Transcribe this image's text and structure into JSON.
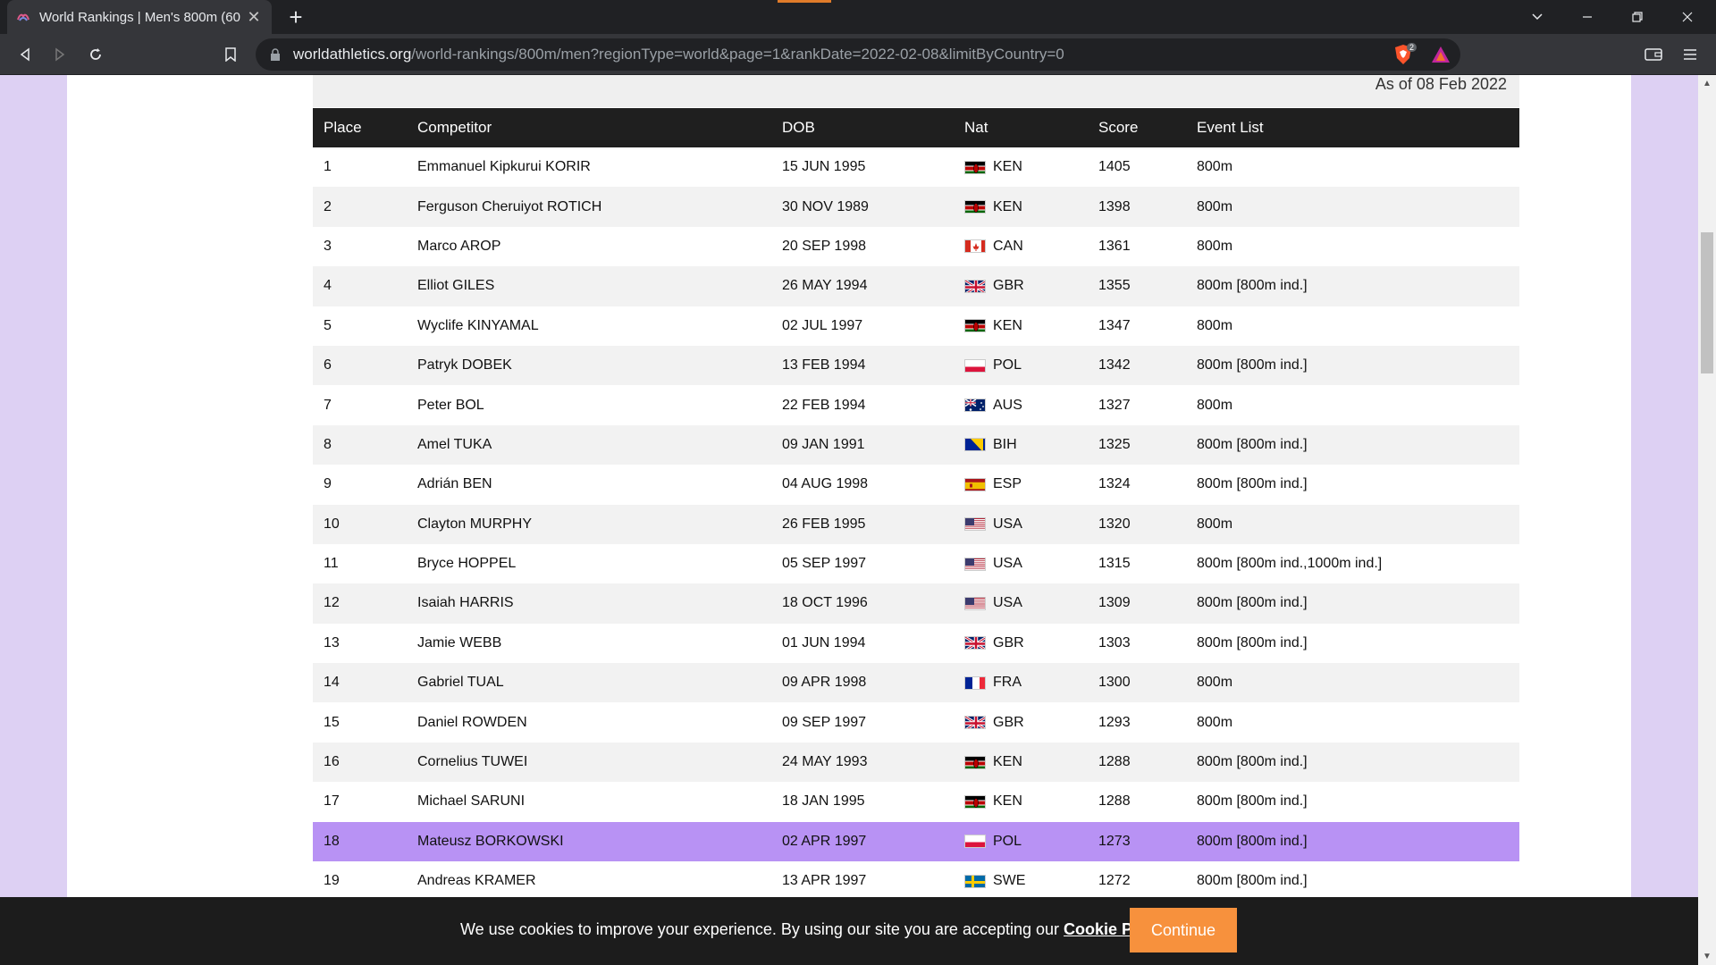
{
  "browser": {
    "tab_title": "World Rankings | Men's 800m (60",
    "tab_close": "✕",
    "new_tab": "+",
    "url_domain": "worldathletics.org",
    "url_path": "/world-rankings/800m/men?regionType=world&page=1&rankDate=2022-02-08&limitByCountry=0",
    "brave_badge": "2"
  },
  "page": {
    "as_of": "As of 08 Feb 2022"
  },
  "table": {
    "headers": {
      "place": "Place",
      "competitor": "Competitor",
      "dob": "DOB",
      "nat": "Nat",
      "score": "Score",
      "events": "Event List"
    },
    "rows": [
      {
        "place": "1",
        "name": "Emmanuel Kipkurui KORIR",
        "dob": "15 JUN 1995",
        "nat": "KEN",
        "score": "1405",
        "events": "800m"
      },
      {
        "place": "2",
        "name": "Ferguson Cheruiyot ROTICH",
        "dob": "30 NOV 1989",
        "nat": "KEN",
        "score": "1398",
        "events": "800m"
      },
      {
        "place": "3",
        "name": "Marco AROP",
        "dob": "20 SEP 1998",
        "nat": "CAN",
        "score": "1361",
        "events": "800m"
      },
      {
        "place": "4",
        "name": "Elliot GILES",
        "dob": "26 MAY 1994",
        "nat": "GBR",
        "score": "1355",
        "events": "800m [800m ind.]"
      },
      {
        "place": "5",
        "name": "Wyclife KINYAMAL",
        "dob": "02 JUL 1997",
        "nat": "KEN",
        "score": "1347",
        "events": "800m"
      },
      {
        "place": "6",
        "name": "Patryk DOBEK",
        "dob": "13 FEB 1994",
        "nat": "POL",
        "score": "1342",
        "events": "800m [800m ind.]"
      },
      {
        "place": "7",
        "name": "Peter BOL",
        "dob": "22 FEB 1994",
        "nat": "AUS",
        "score": "1327",
        "events": "800m"
      },
      {
        "place": "8",
        "name": "Amel TUKA",
        "dob": "09 JAN 1991",
        "nat": "BIH",
        "score": "1325",
        "events": "800m [800m ind.]"
      },
      {
        "place": "9",
        "name": "Adrián BEN",
        "dob": "04 AUG 1998",
        "nat": "ESP",
        "score": "1324",
        "events": "800m [800m ind.]"
      },
      {
        "place": "10",
        "name": "Clayton MURPHY",
        "dob": "26 FEB 1995",
        "nat": "USA",
        "score": "1320",
        "events": "800m"
      },
      {
        "place": "11",
        "name": "Bryce HOPPEL",
        "dob": "05 SEP 1997",
        "nat": "USA",
        "score": "1315",
        "events": "800m [800m ind.,1000m ind.]"
      },
      {
        "place": "12",
        "name": "Isaiah HARRIS",
        "dob": "18 OCT 1996",
        "nat": "USA",
        "score": "1309",
        "events": "800m [800m ind.]"
      },
      {
        "place": "13",
        "name": "Jamie WEBB",
        "dob": "01 JUN 1994",
        "nat": "GBR",
        "score": "1303",
        "events": "800m [800m ind.]"
      },
      {
        "place": "14",
        "name": "Gabriel TUAL",
        "dob": "09 APR 1998",
        "nat": "FRA",
        "score": "1300",
        "events": "800m"
      },
      {
        "place": "15",
        "name": "Daniel ROWDEN",
        "dob": "09 SEP 1997",
        "nat": "GBR",
        "score": "1293",
        "events": "800m"
      },
      {
        "place": "16",
        "name": "Cornelius TUWEI",
        "dob": "24 MAY 1993",
        "nat": "KEN",
        "score": "1288",
        "events": "800m [800m ind.]"
      },
      {
        "place": "17",
        "name": "Michael SARUNI",
        "dob": "18 JAN 1995",
        "nat": "KEN",
        "score": "1288",
        "events": "800m [800m ind.]"
      },
      {
        "place": "18",
        "name": "Mateusz BORKOWSKI",
        "dob": "02 APR 1997",
        "nat": "POL",
        "score": "1273",
        "events": "800m [800m ind.]",
        "highlighted": true
      },
      {
        "place": "19",
        "name": "Andreas KRAMER",
        "dob": "13 APR 1997",
        "nat": "SWE",
        "score": "1272",
        "events": "800m [800m ind.]"
      }
    ]
  },
  "cookie": {
    "text": "We use cookies to improve your experience. By using our site you are accepting our ",
    "link": "Cookie Policy",
    "button": "Continue"
  },
  "colors": {
    "highlight_row": "#b892f4",
    "page_background": "#ddd0f3",
    "cookie_button": "#f7913d",
    "header_row": "#1f1f1f"
  },
  "icons": {
    "tab_favicon": "world-athletics-favicon",
    "back": "back-arrow-icon",
    "forward": "forward-arrow-icon",
    "reload": "reload-icon",
    "bookmark": "bookmark-icon",
    "lock": "lock-icon",
    "brave_shield": "brave-shield-icon",
    "brave_rewards": "brave-rewards-icon",
    "wallet": "wallet-icon",
    "menu": "menu-icon"
  }
}
